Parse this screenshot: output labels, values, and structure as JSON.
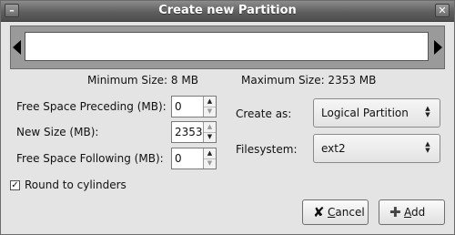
{
  "window": {
    "title": "Create new Partition",
    "menu_icon": "minus-icon",
    "close_icon": "close-icon"
  },
  "partition_bar": {
    "min_size_label": "Minimum Size: 8 MB",
    "max_size_label": "Maximum Size: 2353 MB"
  },
  "form": {
    "free_preceding": {
      "label": "Free Space Preceding (MB):",
      "value": "0"
    },
    "new_size": {
      "label": "New Size (MB):",
      "value": "2353"
    },
    "free_following": {
      "label": "Free Space Following (MB):",
      "value": "0"
    },
    "create_as": {
      "label": "Create as:",
      "selected": "Logical Partition"
    },
    "filesystem": {
      "label": "Filesystem:",
      "selected": "ext2"
    }
  },
  "round_to_cylinders": {
    "label": "Round to cylinders",
    "checked": true
  },
  "buttons": {
    "cancel": {
      "mnemonic": "C",
      "rest": "ancel",
      "icon": "cancel-x-icon"
    },
    "add": {
      "mnemonic": "A",
      "rest": "dd",
      "icon": "add-plus-icon"
    }
  }
}
